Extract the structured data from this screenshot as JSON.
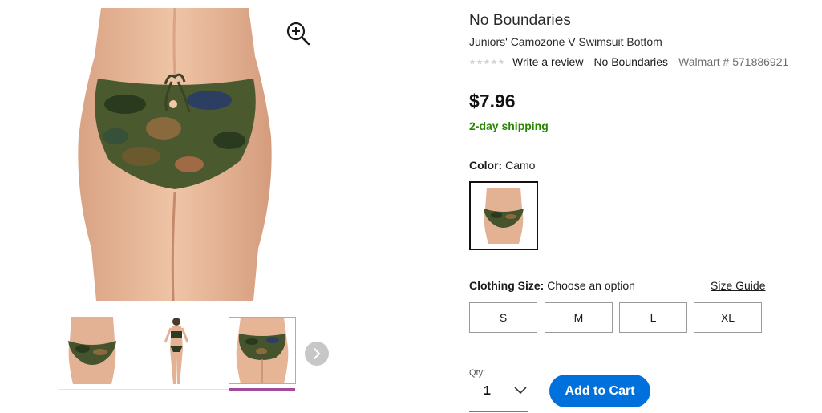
{
  "gallery": {
    "main_image": "product-back-view-photo",
    "zoom_icon": "zoom-in-icon",
    "thumbnails": [
      "front-view",
      "full-body-view",
      "back-view"
    ],
    "active_thumbnail": 3,
    "next_icon": "chevron-right-icon"
  },
  "product": {
    "brand": "No Boundaries",
    "title": "Juniors' Camozone V Swimsuit Bottom",
    "rating_stars": 5,
    "write_review": "Write a review",
    "brand_link": "No Boundaries",
    "item_number": "Walmart # 571886921",
    "price": "$7.96",
    "shipping": "2-day shipping"
  },
  "color": {
    "label": "Color:",
    "value": "Camo"
  },
  "size": {
    "label": "Clothing Size:",
    "value": "Choose an option",
    "guide": "Size Guide",
    "options": [
      "S",
      "M",
      "L",
      "XL"
    ]
  },
  "cart": {
    "qty_label": "Qty:",
    "qty_value": "1",
    "add_to_cart": "Add to Cart"
  },
  "colors": {
    "accent": "#0071dc",
    "shipping_green": "#2a8703",
    "active_thumb_bar": "#a24a9c"
  }
}
